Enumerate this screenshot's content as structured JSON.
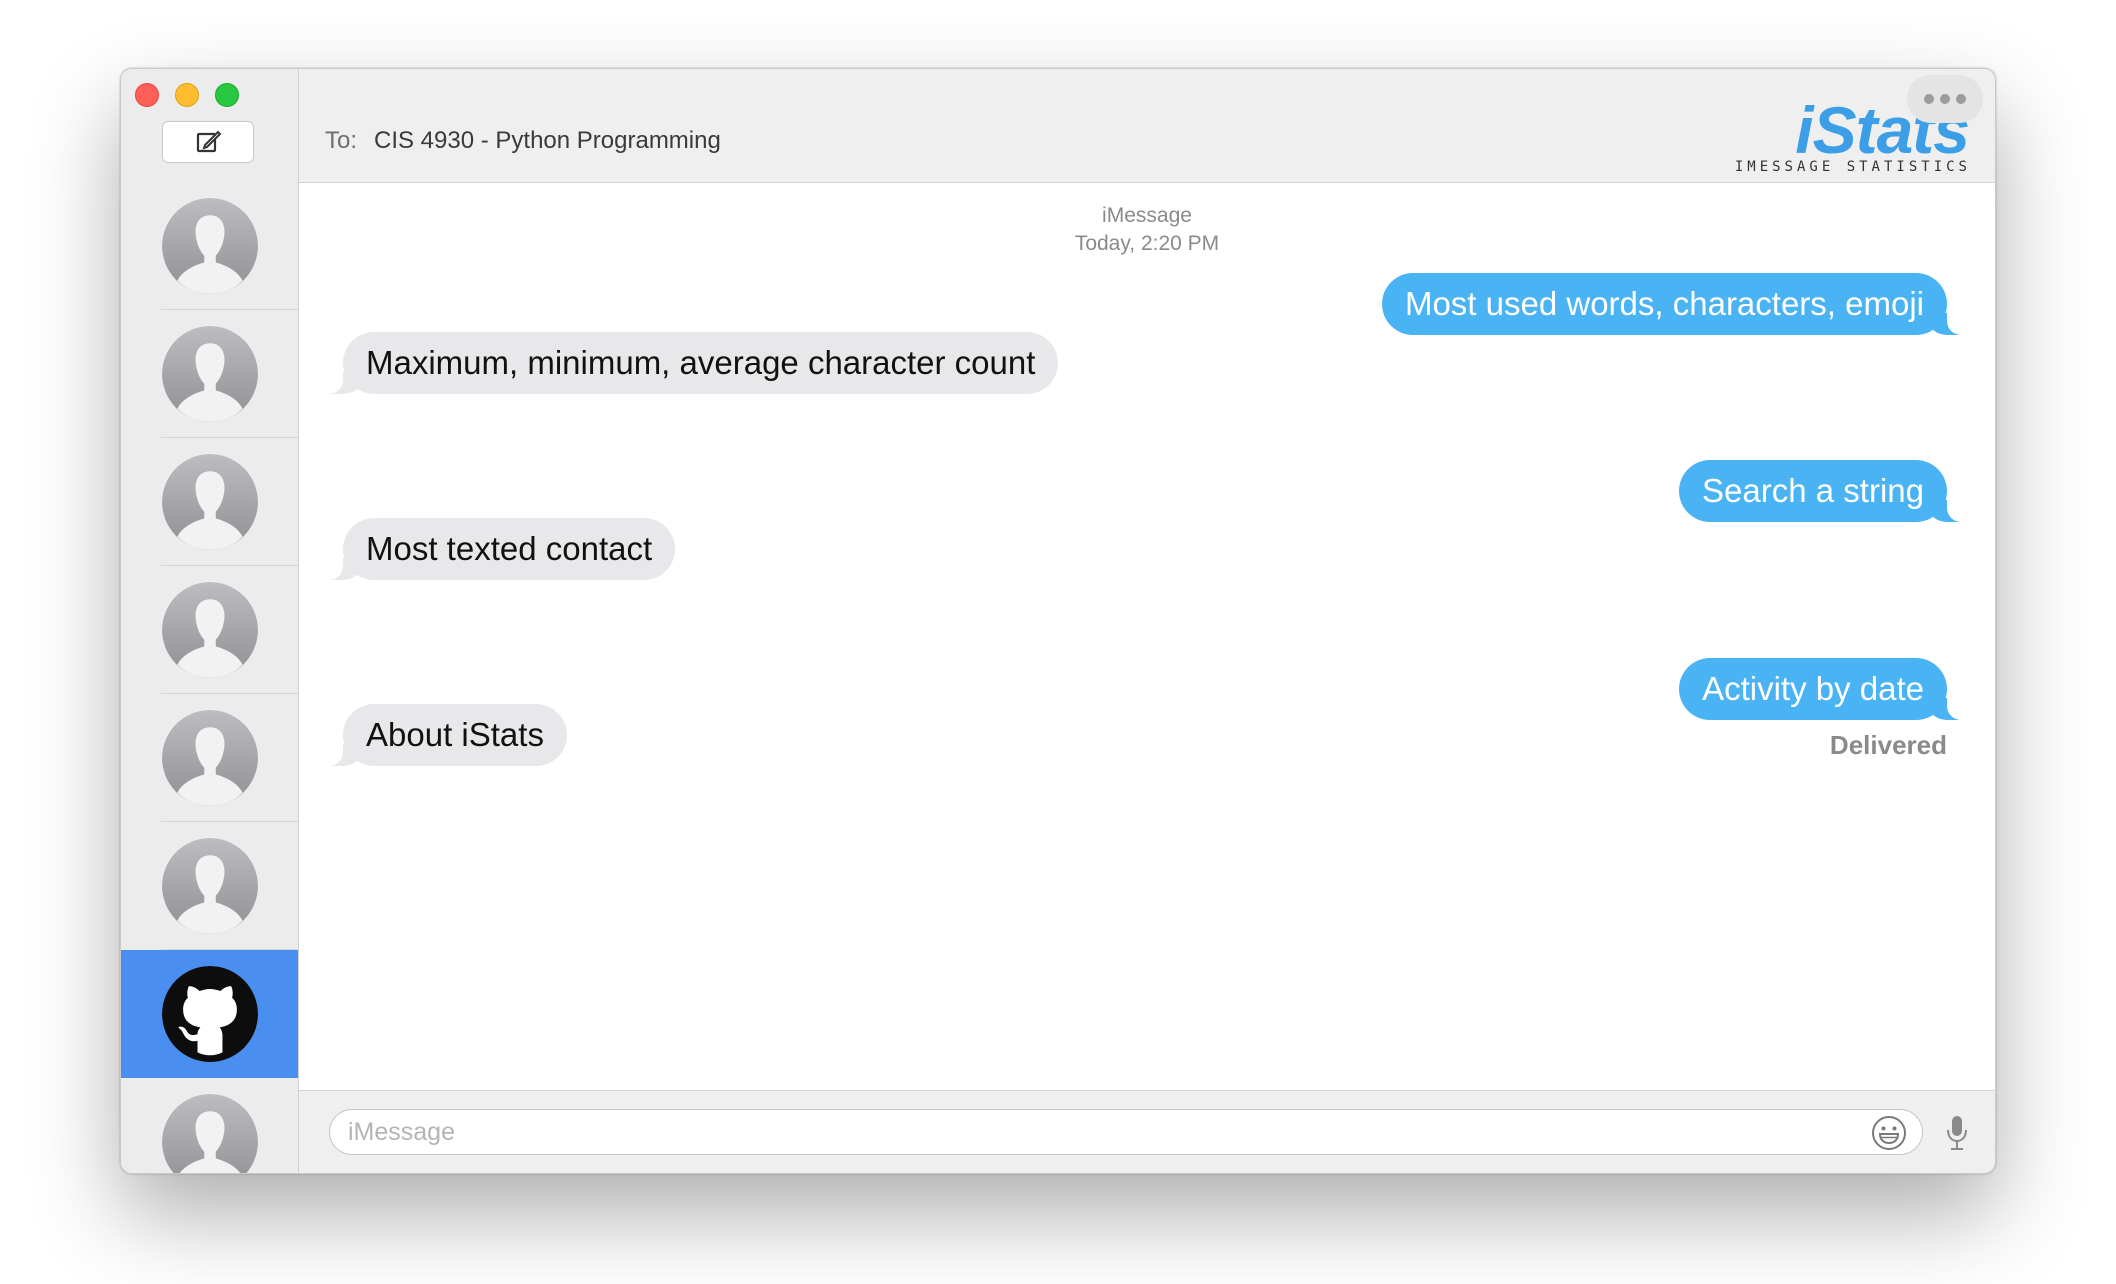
{
  "window": {
    "traffic_lights": {
      "close": "#fe5f57",
      "minimize": "#febc2e",
      "maximize": "#28c840"
    }
  },
  "sidebar": {
    "compose_icon": "compose-icon",
    "contacts": [
      {
        "avatar": "default-person-avatar",
        "selected": false
      },
      {
        "avatar": "default-person-avatar",
        "selected": false
      },
      {
        "avatar": "default-person-avatar",
        "selected": false
      },
      {
        "avatar": "default-person-avatar",
        "selected": false
      },
      {
        "avatar": "default-person-avatar",
        "selected": false
      },
      {
        "avatar": "default-person-avatar",
        "selected": false
      },
      {
        "avatar": "github-avatar",
        "selected": true
      },
      {
        "avatar": "default-person-avatar",
        "selected": false
      }
    ],
    "selected_color": "#4a8ef0"
  },
  "header": {
    "to_label": "To:",
    "to_value": "CIS 4930 - Python Programming",
    "logo_text": "iStats",
    "logo_subtitle": "IMESSAGE STATISTICS",
    "more_icon": "more-dots-icon"
  },
  "chat": {
    "service": "iMessage",
    "timestamp": "Today, 2:20 PM",
    "messages": [
      {
        "direction": "outgoing",
        "text": "Most used words, characters, emoji"
      },
      {
        "direction": "incoming",
        "text": "Maximum, minimum, average character count"
      },
      {
        "direction": "outgoing",
        "text": "Search a string"
      },
      {
        "direction": "incoming",
        "text": "Most texted contact"
      },
      {
        "direction": "outgoing",
        "text": "Activity by date"
      },
      {
        "direction": "incoming",
        "text": "About iStats"
      }
    ],
    "delivered_label": "Delivered",
    "outgoing_color": "#4ab3f4",
    "incoming_color": "#e8e8ea"
  },
  "input": {
    "placeholder": "iMessage",
    "value": "",
    "emoji_icon": "emoji-icon",
    "mic_icon": "microphone-icon"
  }
}
